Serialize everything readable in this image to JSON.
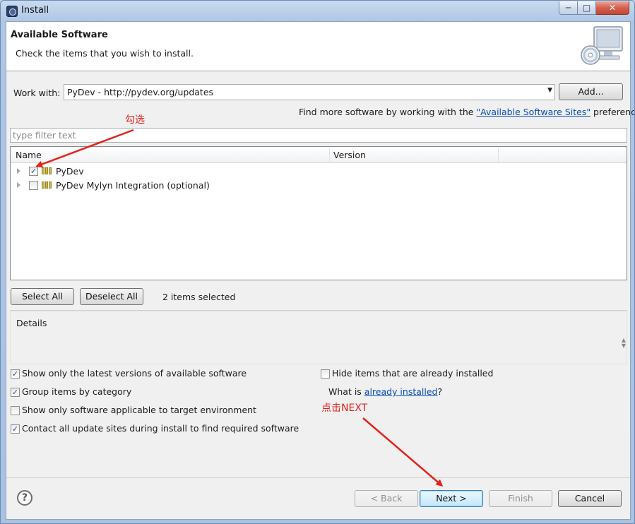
{
  "window": {
    "title": "Install",
    "minimize_glyph": "─",
    "maximize_glyph": "□",
    "close_glyph": "✕"
  },
  "banner": {
    "title": "Available Software",
    "subtitle": "Check the items that you wish to install.",
    "icon": "monitor-cd-icon"
  },
  "work_with": {
    "label": "Work with:",
    "value": "PyDev - http://pydev.org/updates",
    "add_button": "Add..."
  },
  "find_more": {
    "prefix": "Find more software by working with the ",
    "link": "\"Available Software Sites\"",
    "suffix": " preferences."
  },
  "filter": {
    "placeholder": "type filter text"
  },
  "tree": {
    "columns": [
      "Name",
      "Version"
    ],
    "items": [
      {
        "label": "PyDev",
        "checked": true
      },
      {
        "label": "PyDev Mylyn Integration (optional)",
        "checked": false
      }
    ]
  },
  "selection": {
    "select_all": "Select All",
    "deselect_all": "Deselect All",
    "status": "2 items selected"
  },
  "details": {
    "label": "Details"
  },
  "options": {
    "latest_versions": {
      "label": "Show only the latest versions of available software",
      "checked": true
    },
    "group_by_category": {
      "label": "Group items by category",
      "checked": true
    },
    "target_env": {
      "label": "Show only software applicable to target environment",
      "checked": false
    },
    "contact_sites": {
      "label": "Contact all update sites during install to find required software",
      "checked": true
    },
    "hide_installed": {
      "label": "Hide items that are already installed",
      "checked": false
    },
    "what_is_prefix": "What is ",
    "what_is_link": "already installed",
    "what_is_suffix": "?"
  },
  "footer": {
    "help_glyph": "?",
    "back": "< Back",
    "next": "Next >",
    "finish": "Finish",
    "cancel": "Cancel"
  },
  "annotations": {
    "check_note": "勾选",
    "next_note": "点击NEXT",
    "color": "#e2231a"
  },
  "check_glyph": "✓"
}
